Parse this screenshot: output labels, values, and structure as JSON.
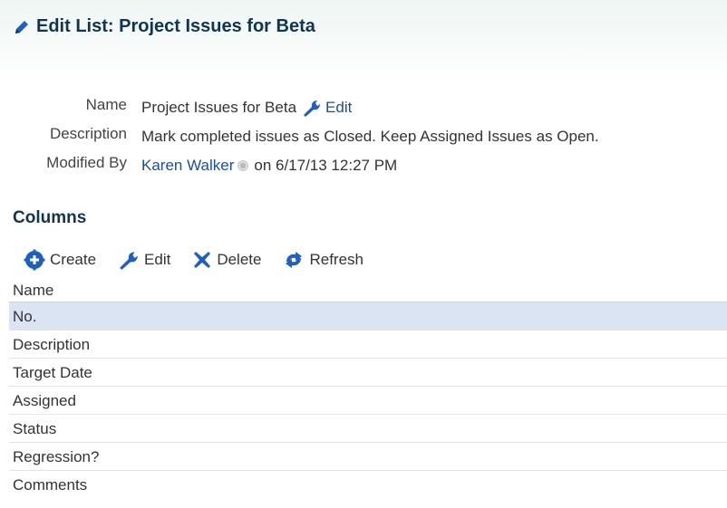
{
  "page": {
    "title": "Edit List: Project Issues for Beta"
  },
  "details": {
    "name_label": "Name",
    "name_value": "Project Issues for Beta",
    "name_edit_label": "Edit",
    "description_label": "Description",
    "description_value": "Mark completed issues as Closed. Keep Assigned Issues as Open.",
    "modified_label": "Modified By",
    "modified_user": "Karen Walker",
    "modified_date": "on 6/17/13 12:27 PM"
  },
  "columns": {
    "title": "Columns",
    "toolbar": {
      "create": "Create",
      "edit": "Edit",
      "delete": "Delete",
      "refresh": "Refresh"
    },
    "header": "Name",
    "rows": [
      "No.",
      "Description",
      "Target Date",
      "Assigned",
      "Status",
      "Regression?",
      "Comments"
    ],
    "selected_index": 0
  },
  "icons": {
    "title": "pencil-icon",
    "name_edit": "wrench-icon",
    "presence": "presence-status-icon",
    "create": "gear-plus-icon",
    "edit": "wrench-icon",
    "delete": "x-icon",
    "refresh": "refresh-icon"
  },
  "colors": {
    "heading": "#0f3550",
    "link": "#1a4fa0",
    "icon_blue": "#1f5fbf",
    "selected_row": "#dae4f2"
  }
}
